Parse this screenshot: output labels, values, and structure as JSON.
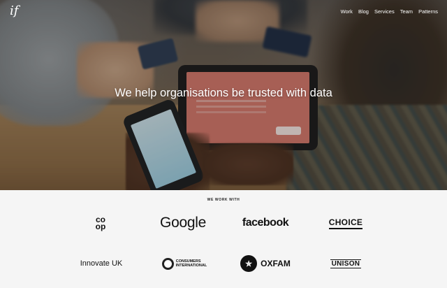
{
  "header": {
    "logo_text": "if",
    "nav": [
      "Work",
      "Blog",
      "Services",
      "Team",
      "Patterns"
    ]
  },
  "hero": {
    "headline": "We help organisations be trusted with data"
  },
  "clients": {
    "label": "WE WORK WITH",
    "logos": {
      "coop_line1": "co",
      "coop_line2": "op",
      "google": "Google",
      "facebook": "facebook",
      "choice": "CHOICE",
      "innovate": "Innovate UK",
      "consumers_line1": "CONSUMERS",
      "consumers_line2": "INTERNATIONAL",
      "oxfam": "OXFAM",
      "unison": "UNISON"
    }
  }
}
